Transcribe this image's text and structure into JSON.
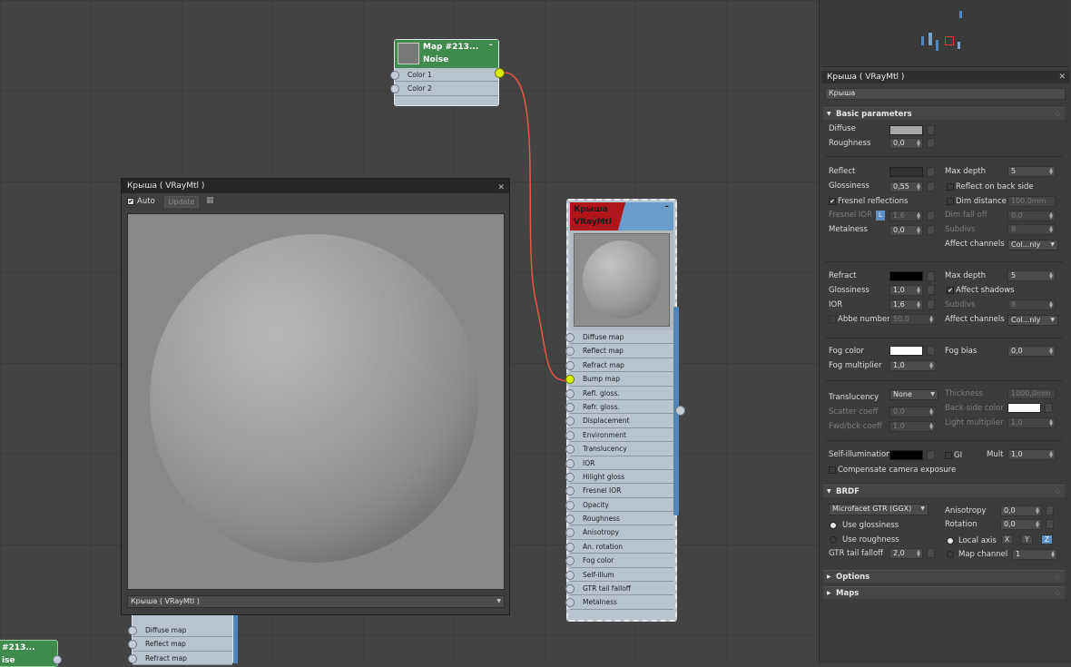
{
  "noise_node": {
    "title_line1": "Map #213...",
    "title_line2": "Noise",
    "slots": [
      "Color 1",
      "Color 2"
    ]
  },
  "small_node": {
    "title_line1": "#213...",
    "title_line2": "ise"
  },
  "behind_node": {
    "slots": [
      "Diffuse map",
      "Reflect map",
      "Refract map"
    ]
  },
  "material_node": {
    "title_line1": "Крыша",
    "title_line2": "VRayMtl",
    "slots": [
      "Diffuse map",
      "Reflect map",
      "Refract map",
      "Bump map",
      "Refl. gloss.",
      "Refr. gloss.",
      "Displacement",
      "Environment",
      "Translucency",
      "IOR",
      "Hilight gloss",
      "Fresnel IOR",
      "Opacity",
      "Roughness",
      "Anisotropy",
      "An. rotation",
      "Fog color",
      "Self-illum",
      "GTR tail falloff",
      "Metalness"
    ]
  },
  "preview": {
    "title": "Крыша  ( VRayMtl )",
    "auto_label": "Auto",
    "update_label": "Update",
    "dropdown_value": "Крыша  ( VRayMtl )"
  },
  "panel": {
    "title": "Крыша  ( VRayMtl )",
    "name_field": "Крыша",
    "basic_header": "Basic parameters",
    "diffuse": "Diffuse",
    "roughness": "Roughness",
    "roughness_val": "0,0",
    "reflect": "Reflect",
    "max_depth": "Max depth",
    "max_depth_val": "5",
    "glossiness": "Glossiness",
    "refl_gloss_val": "0,55",
    "reflect_backside": "Reflect on back side",
    "fresnel": "Fresnel reflections",
    "dim_distance": "Dim distance",
    "dim_distance_val": "100,0mm",
    "fresnel_ior": "Fresnel IOR",
    "fresnel_ior_lock": "L",
    "fresnel_ior_val": "1,6",
    "dim_falloff": "Dim fall off",
    "dim_falloff_val": "0,0",
    "metalness": "Metalness",
    "metalness_val": "0,0",
    "subdivs": "Subdivs",
    "subdivs_val": "8",
    "affect_channels": "Affect channels",
    "affect_channels_val": "Col...nly",
    "refract": "Refract",
    "refr_max_depth_val": "5",
    "refr_gloss_val": "1,0",
    "affect_shadows": "Affect shadows",
    "ior": "IOR",
    "ior_val": "1,6",
    "refr_subdivs_val": "8",
    "abbe": "Abbe number",
    "abbe_val": "50,0",
    "refr_affect_val": "Col...nly",
    "fog_color": "Fog color",
    "fog_bias": "Fog bias",
    "fog_bias_val": "0,0",
    "fog_mult": "Fog multiplier",
    "fog_mult_val": "1,0",
    "translucency": "Translucency",
    "translucency_val": "None",
    "thickness": "Thickness",
    "thickness_val": "1000,0mm",
    "scatter": "Scatter coeff",
    "scatter_val": "0,0",
    "backside_color": "Back-side color",
    "fwdbck": "Fwd/bck coeff",
    "fwdbck_val": "1,0",
    "light_mult": "Light multiplier",
    "light_mult_val": "1,0",
    "self_illum": "Self-illumination",
    "gi": "GI",
    "mult": "Mult",
    "mult_val": "1,0",
    "compensate": "Compensate camera exposure",
    "brdf_header": "BRDF",
    "brdf_type": "Microfacet GTR (GGX)",
    "anisotropy": "Anisotropy",
    "anisotropy_val": "0,0",
    "use_glossiness": "Use glossiness",
    "rotation": "Rotation",
    "rotation_val": "0,0",
    "use_roughness": "Use roughness",
    "local_axis": "Local axis",
    "axis_x": "X",
    "axis_y": "Y",
    "axis_z": "Z",
    "gtr_tail": "GTR tail falloff",
    "gtr_tail_val": "2,0",
    "map_channel": "Map channel",
    "map_channel_val": "1",
    "options_header": "Options",
    "maps_header": "Maps"
  },
  "colors": {
    "noise_header": "#3f8a4d",
    "mtl_header_red": "#b0151b",
    "mtl_header_blue": "#6a9ccc",
    "wire": "#e8554a",
    "socket_active": "#d8f000"
  }
}
